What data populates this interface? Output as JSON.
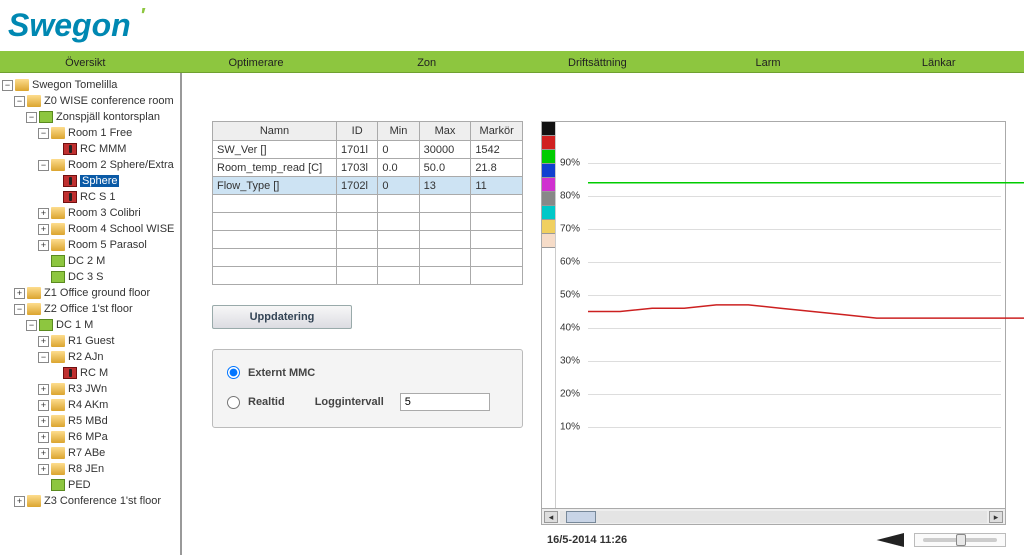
{
  "brand": "Swegon",
  "menu": [
    "Översikt",
    "Optimerare",
    "Zon",
    "Driftsättning",
    "Larm",
    "Länkar"
  ],
  "tree": {
    "root": "Swegon Tomelilla",
    "z0": "Z0 WISE conference room",
    "zonspjall": "Zonspjäll kontorsplan",
    "room1": "Room 1 Free",
    "rc_mmm": "RC MMM",
    "room2": "Room 2 Sphere/Extra",
    "sphere": "Sphere",
    "rcs1": "RC S 1",
    "room3": "Room 3 Colibri",
    "room4": "Room 4 School WISE",
    "room5": "Room 5 Parasol",
    "dc2m": "DC 2 M",
    "dc3s": "DC 3 S",
    "z1": "Z1 Office ground floor",
    "z2": "Z2 Office 1'st floor",
    "dc1m": "DC 1 M",
    "r1": "R1 Guest",
    "r2": "R2 AJn",
    "rcm": "RC M",
    "r3": "R3 JWn",
    "r4": "R4 AKm",
    "r5": "R5 MBd",
    "r6": "R6 MPa",
    "r7": "R7 ABe",
    "r8": "R8 JEn",
    "ped": "PED",
    "z3": "Z3 Conference 1'st floor"
  },
  "table": {
    "headers": [
      "Namn",
      "ID",
      "Min",
      "Max",
      "Markör"
    ],
    "rows": [
      {
        "name": "SW_Ver []",
        "id": "1701l",
        "min": "0",
        "max": "30000",
        "mark": "1542"
      },
      {
        "name": "Room_temp_read [C]",
        "id": "1703l",
        "min": "0.0",
        "max": "50.0",
        "mark": "21.8"
      },
      {
        "name": "Flow_Type []",
        "id": "1702l",
        "min": "0",
        "max": "13",
        "mark": "11"
      }
    ]
  },
  "buttons": {
    "update": "Uppdatering"
  },
  "options": {
    "externt": "Externt MMC",
    "realtid": "Realtid",
    "loggintervall_label": "Loggintervall",
    "loggintervall_value": "5"
  },
  "chart_data": {
    "type": "line",
    "x": null,
    "ylim": [
      0,
      100
    ],
    "yticks": [
      10,
      20,
      30,
      40,
      50,
      60,
      70,
      80,
      90
    ],
    "series": [
      {
        "name": "Flow_Type",
        "color": "#00cc00",
        "values_pct": [
          84,
          84,
          84,
          84,
          84,
          84,
          84,
          84,
          84,
          84,
          84,
          84,
          84,
          84,
          84
        ]
      },
      {
        "name": "Room_temp_read",
        "color": "#cc2020",
        "values_pct": [
          45,
          45,
          46,
          46,
          47,
          47,
          46,
          45,
          44,
          43,
          43,
          43,
          43,
          43,
          43
        ]
      }
    ],
    "palette": [
      "#111111",
      "#d02020",
      "#00cc00",
      "#1040d0",
      "#d030d0",
      "#888888",
      "#00c8c8",
      "#f0d060",
      "#f6dcc8"
    ]
  },
  "timestamp": "16/5-2014 11:26"
}
